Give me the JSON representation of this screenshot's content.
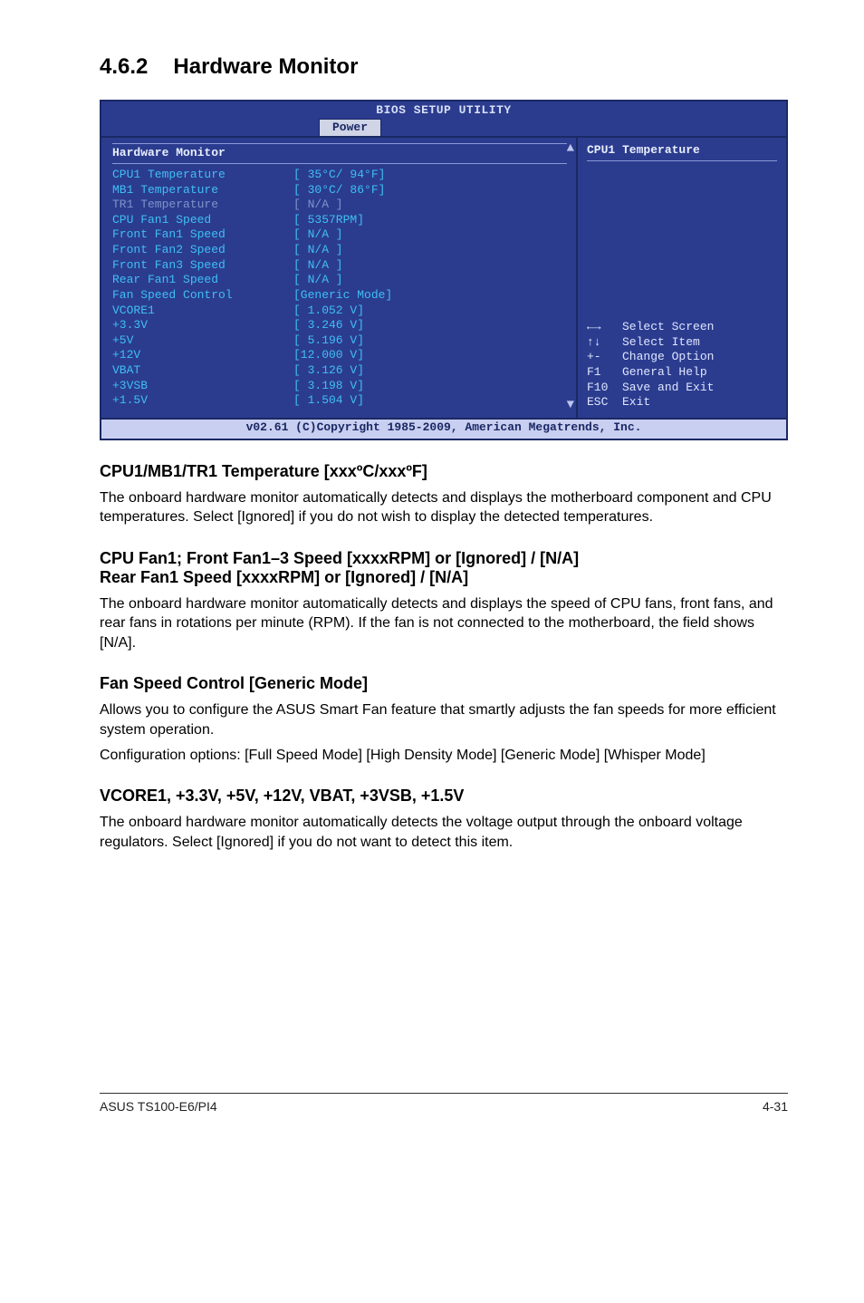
{
  "section": {
    "number": "4.6.2",
    "title": "Hardware Monitor"
  },
  "bios": {
    "header": "BIOS SETUP UTILITY",
    "tab": "Power",
    "panel_title": "Hardware Monitor",
    "rows": [
      {
        "label": "CPU1 Temperature",
        "value": "[ 35°C/ 94°F]",
        "dim": false
      },
      {
        "label": "MB1 Temperature",
        "value": "[ 30°C/ 86°F]",
        "dim": false
      },
      {
        "label": "TR1 Temperature",
        "value": "[  N/A  ]",
        "dim": true
      },
      {
        "label": "CPU Fan1 Speed",
        "value": "[ 5357RPM]",
        "dim": false
      },
      {
        "label": "Front Fan1 Speed",
        "value": "[  N/A  ]",
        "dim": false
      },
      {
        "label": "Front Fan2 Speed",
        "value": "[  N/A  ]",
        "dim": false
      },
      {
        "label": "Front Fan3 Speed",
        "value": "[  N/A  ]",
        "dim": false
      },
      {
        "label": "Rear Fan1 Speed",
        "value": "[  N/A  ]",
        "dim": false
      },
      {
        "label": "Fan Speed Control",
        "value": "[Generic Mode]",
        "dim": false
      },
      {
        "label": "VCORE1",
        "value": "[ 1.052 V]",
        "dim": false
      },
      {
        "label": "+3.3V",
        "value": "[ 3.246 V]",
        "dim": false
      },
      {
        "label": "+5V",
        "value": "[ 5.196 V]",
        "dim": false
      },
      {
        "label": "+12V",
        "value": "[12.000 V]",
        "dim": false
      },
      {
        "label": "VBAT",
        "value": "[ 3.126 V]",
        "dim": false
      },
      {
        "label": "+3VSB",
        "value": "[ 3.198 V]",
        "dim": false
      },
      {
        "label": "+1.5V",
        "value": "[ 1.504 V]",
        "dim": false
      }
    ],
    "help_title": "CPU1 Temperature",
    "nav": {
      "l1": "←→   Select Screen",
      "l2": "↑↓   Select Item",
      "l3": "+-   Change Option",
      "l4": "F1   General Help",
      "l5": "F10  Save and Exit",
      "l6": "ESC  Exit"
    },
    "footer": "v02.61 (C)Copyright 1985-2009, American Megatrends, Inc."
  },
  "doc": {
    "h1": "CPU1/MB1/TR1 Temperature [xxxºC/xxxºF]",
    "p1": "The onboard hardware monitor automatically detects and displays the motherboard component and CPU temperatures. Select [Ignored] if you do not wish to display the detected temperatures.",
    "h2a": "CPU Fan1; Front Fan1–3 Speed [xxxxRPM] or [Ignored] / [N/A]",
    "h2b": "Rear Fan1 Speed [xxxxRPM] or [Ignored] / [N/A]",
    "p2": "The onboard hardware monitor automatically detects and displays the speed of CPU fans, front fans, and rear fans in rotations per minute (RPM). If the fan is not connected to the motherboard, the field shows [N/A].",
    "h3": "Fan Speed Control [Generic Mode]",
    "p3a": "Allows you to configure the ASUS Smart Fan feature that smartly adjusts the fan speeds for more efficient system operation.",
    "p3b": "Configuration options: [Full Speed Mode] [High Density Mode] [Generic Mode] [Whisper Mode]",
    "h4": "VCORE1, +3.3V, +5V, +12V, VBAT, +3VSB, +1.5V",
    "p4": "The onboard hardware monitor automatically detects the voltage output through the onboard voltage regulators. Select [Ignored] if you do not want to detect this item."
  },
  "footer": {
    "left": "ASUS TS100-E6/PI4",
    "right": "4-31"
  }
}
